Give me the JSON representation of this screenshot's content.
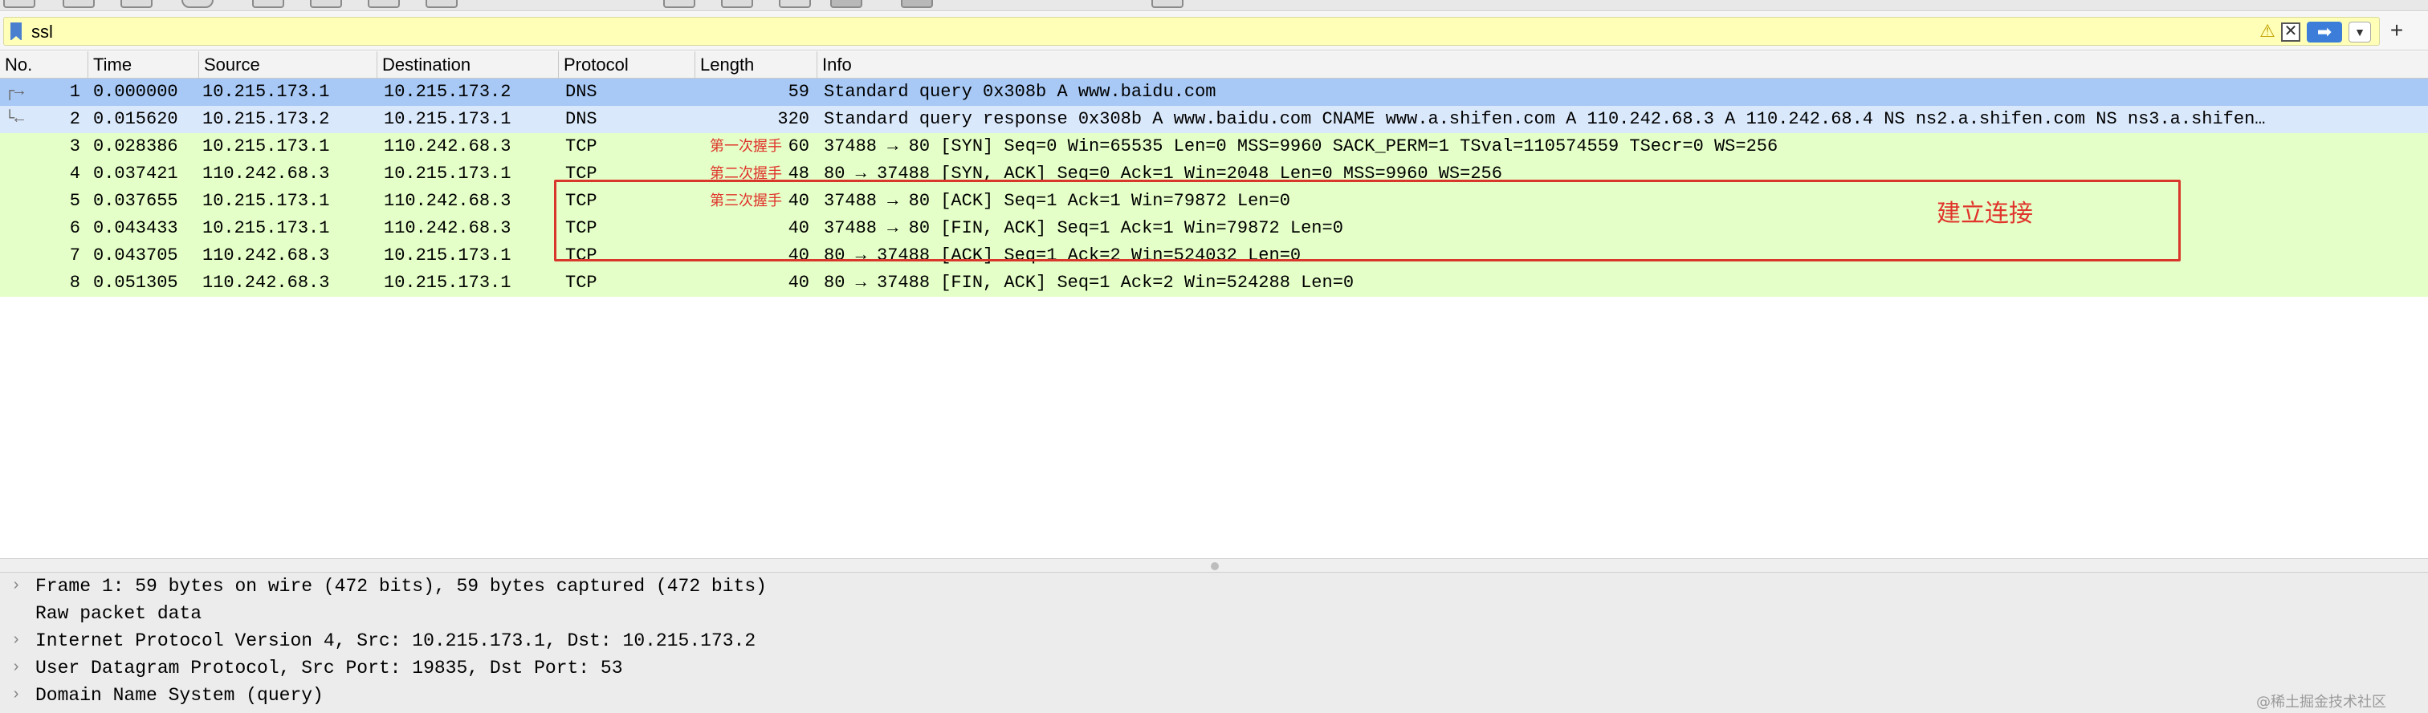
{
  "filter": {
    "value": "ssl",
    "warning_icon": "warning-icon",
    "clear_icon": "clear-icon",
    "apply_icon": "apply-arrow-icon",
    "dropdown_icon": "chevron-down-icon",
    "add_icon": "plus-icon"
  },
  "columns": {
    "no": "No.",
    "time": "Time",
    "source": "Source",
    "destination": "Destination",
    "protocol": "Protocol",
    "length": "Length",
    "info": "Info"
  },
  "packets": [
    {
      "no": "1",
      "time": "0.000000",
      "source": "10.215.173.1",
      "destination": "10.215.173.2",
      "protocol": "DNS",
      "length": "59",
      "info": "Standard query 0x308b A www.baidu.com"
    },
    {
      "no": "2",
      "time": "0.015620",
      "source": "10.215.173.2",
      "destination": "10.215.173.1",
      "protocol": "DNS",
      "length": "320",
      "info": "Standard query response 0x308b A www.baidu.com CNAME www.a.shifen.com A 110.242.68.3 A 110.242.68.4 NS ns2.a.shifen.com NS ns3.a.shifen…"
    },
    {
      "no": "3",
      "time": "0.028386",
      "source": "10.215.173.1",
      "destination": "110.242.68.3",
      "protocol": "TCP",
      "length": "60",
      "info": "37488 → 80 [SYN] Seq=0 Win=65535 Len=0 MSS=9960 SACK_PERM=1 TSval=110574559 TSecr=0 WS=256",
      "note": "第一次握手"
    },
    {
      "no": "4",
      "time": "0.037421",
      "source": "110.242.68.3",
      "destination": "10.215.173.1",
      "protocol": "TCP",
      "length": "48",
      "info": "80 → 37488 [SYN, ACK] Seq=0 Ack=1 Win=2048 Len=0 MSS=9960 WS=256",
      "note": "第二次握手"
    },
    {
      "no": "5",
      "time": "0.037655",
      "source": "10.215.173.1",
      "destination": "110.242.68.3",
      "protocol": "TCP",
      "length": "40",
      "info": "37488 → 80 [ACK] Seq=1 Ack=1 Win=79872 Len=0",
      "note": "第三次握手"
    },
    {
      "no": "6",
      "time": "0.043433",
      "source": "10.215.173.1",
      "destination": "110.242.68.3",
      "protocol": "TCP",
      "length": "40",
      "info": "37488 → 80 [FIN, ACK] Seq=1 Ack=1 Win=79872 Len=0"
    },
    {
      "no": "7",
      "time": "0.043705",
      "source": "110.242.68.3",
      "destination": "10.215.173.1",
      "protocol": "TCP",
      "length": "40",
      "info": "80 → 37488 [ACK] Seq=1 Ack=2 Win=524032 Len=0"
    },
    {
      "no": "8",
      "time": "0.051305",
      "source": "110.242.68.3",
      "destination": "10.215.173.1",
      "protocol": "TCP",
      "length": "40",
      "info": "80 → 37488 [FIN, ACK] Seq=1 Ack=2 Win=524288 Len=0"
    }
  ],
  "annotation": {
    "label": "建立连接",
    "color": "#e0342c"
  },
  "details": [
    {
      "text": "Frame 1: 59 bytes on wire (472 bits), 59 bytes captured (472 bits)",
      "expandable": true
    },
    {
      "text": "Raw packet data",
      "expandable": false
    },
    {
      "text": "Internet Protocol Version 4, Src: 10.215.173.1, Dst: 10.215.173.2",
      "expandable": true
    },
    {
      "text": "User Datagram Protocol, Src Port: 19835, Dst Port: 53",
      "expandable": true
    },
    {
      "text": "Domain Name System (query)",
      "expandable": true
    }
  ],
  "watermark": "@稀土掘金技术社区",
  "colors": {
    "dns_row": "#dae8fb",
    "dns_selected": "#a8c9f5",
    "tcp_row": "#e4ffc7",
    "filter_bg": "#ffffb8",
    "annotation": "#d9362c"
  }
}
